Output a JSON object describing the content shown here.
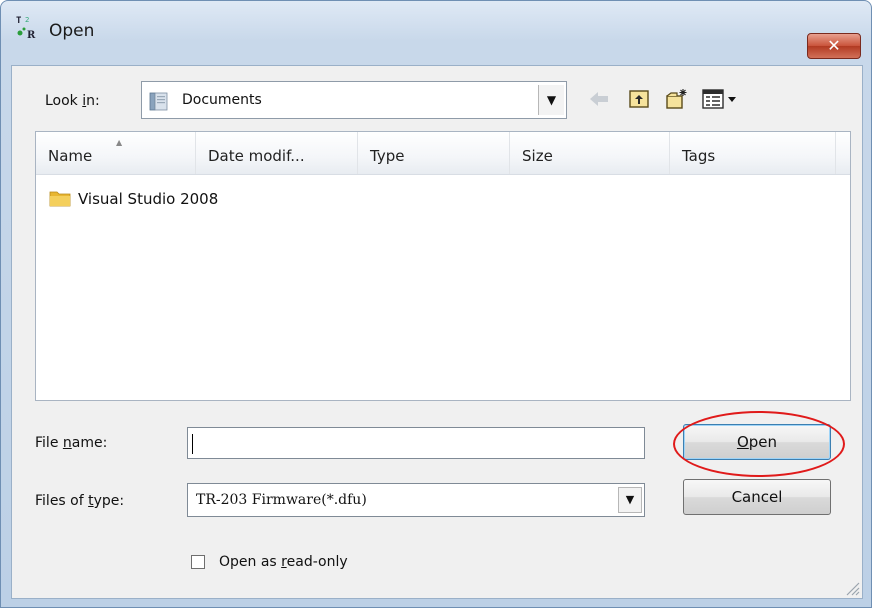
{
  "window": {
    "title": "Open",
    "close_glyph": "✕"
  },
  "icons": {
    "app": "app-tr-icon",
    "lookin": "documents-library-icon",
    "back": "back-arrow-icon",
    "up": "up-folder-icon",
    "new_folder": "new-folder-icon",
    "views": "views-menu-icon",
    "folder": "folder-icon",
    "combo_arrow": "▼"
  },
  "lookin": {
    "label": "Look in:",
    "value": "Documents"
  },
  "columns": [
    {
      "label": "Name"
    },
    {
      "label": "Date modif..."
    },
    {
      "label": "Type"
    },
    {
      "label": "Size"
    },
    {
      "label": "Tags"
    }
  ],
  "files": [
    {
      "name": "Visual Studio 2008"
    }
  ],
  "filename": {
    "label_pre": "File ",
    "label_u": "n",
    "label_post": "ame:",
    "value": ""
  },
  "filetype": {
    "label_pre": "Files of ",
    "label_u": "t",
    "label_post": "ype:",
    "value": "TR-203 Firmware(*.dfu)"
  },
  "buttons": {
    "open": {
      "u": "O",
      "rest": "pen"
    },
    "cancel": "Cancel"
  },
  "readonly": {
    "pre": "Open as ",
    "u": "r",
    "post": "ead-only",
    "checked": false
  },
  "colors": {
    "highlight": "#e01a1a",
    "folder": "#e8b632",
    "close": "#c9533a"
  }
}
